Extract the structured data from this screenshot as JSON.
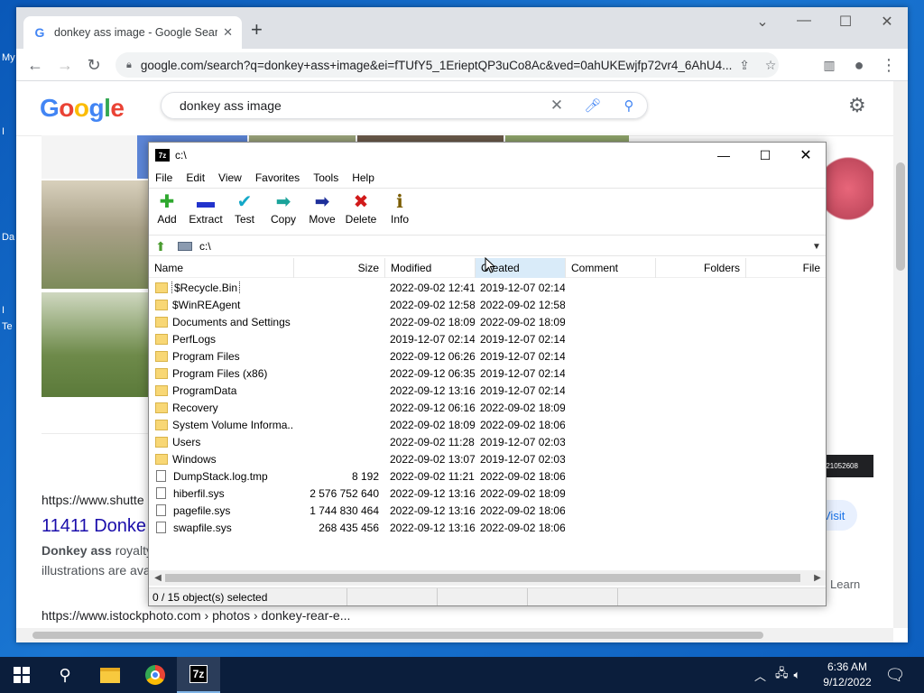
{
  "desktop": {
    "labels": [
      "My",
      "I",
      "Da",
      "I",
      "Te"
    ]
  },
  "chrome": {
    "tab_title": "donkey ass image - Google Sear",
    "url": "google.com/search?q=donkey+ass+image&ei=fTUfY5_1ErieptQP3uCo8Ac&ved=0ahUKEwjfp72vr4_6AhU4...",
    "window_controls": {
      "minimize": "—",
      "maximize": "☐",
      "close": "✕"
    }
  },
  "google": {
    "logo": "Google",
    "query": "donkey ass image",
    "result1_url": "https://www.shutte",
    "result1_title": "11411 Donke",
    "result1_snippet_bold": "Donkey ass",
    "result1_snippet_rest": " royalty",
    "result1_snippet_line2": "illustrations are ava",
    "result2_url": "https://www.istockphoto.com › photos › donkey-rear-e...",
    "card_text": "om/21052608",
    "visit": "Visit",
    "learn": "Learn"
  },
  "zip": {
    "title": "c:\\",
    "menu": [
      "File",
      "Edit",
      "View",
      "Favorites",
      "Tools",
      "Help"
    ],
    "toolbar": [
      {
        "label": "Add",
        "icon": "✚",
        "color": "#2ea82e"
      },
      {
        "label": "Extract",
        "icon": "▬",
        "color": "#2233cc"
      },
      {
        "label": "Test",
        "icon": "✔",
        "color": "#14a8c8"
      },
      {
        "label": "Copy",
        "icon": "➡",
        "color": "#1aa39a"
      },
      {
        "label": "Move",
        "icon": "➡",
        "color": "#1e2f9a"
      },
      {
        "label": "Delete",
        "icon": "✖",
        "color": "#d11a1a"
      },
      {
        "label": "Info",
        "icon": "ℹ",
        "color": "#7a5c00"
      }
    ],
    "address": "c:\\",
    "columns": [
      "Name",
      "Size",
      "Modified",
      "Created",
      "Comment",
      "Folders",
      "File"
    ],
    "rows": [
      {
        "name": "$Recycle.Bin",
        "type": "folder",
        "size": "",
        "modified": "2022-09-02 12:41",
        "created": "2019-12-07 02:14"
      },
      {
        "name": "$WinREAgent",
        "type": "folder",
        "size": "",
        "modified": "2022-09-02 12:58",
        "created": "2022-09-02 12:58"
      },
      {
        "name": "Documents and Settings",
        "type": "folder",
        "size": "",
        "modified": "2022-09-02 18:09",
        "created": "2022-09-02 18:09"
      },
      {
        "name": "PerfLogs",
        "type": "folder",
        "size": "",
        "modified": "2019-12-07 02:14",
        "created": "2019-12-07 02:14"
      },
      {
        "name": "Program Files",
        "type": "folder",
        "size": "",
        "modified": "2022-09-12 06:26",
        "created": "2019-12-07 02:14"
      },
      {
        "name": "Program Files (x86)",
        "type": "folder",
        "size": "",
        "modified": "2022-09-12 06:35",
        "created": "2019-12-07 02:14"
      },
      {
        "name": "ProgramData",
        "type": "folder",
        "size": "",
        "modified": "2022-09-12 13:16",
        "created": "2019-12-07 02:14"
      },
      {
        "name": "Recovery",
        "type": "folder",
        "size": "",
        "modified": "2022-09-12 06:16",
        "created": "2022-09-02 18:09"
      },
      {
        "name": "System Volume Informa...",
        "type": "folder",
        "size": "",
        "modified": "2022-09-02 18:09",
        "created": "2022-09-02 18:06"
      },
      {
        "name": "Users",
        "type": "folder",
        "size": "",
        "modified": "2022-09-02 11:28",
        "created": "2019-12-07 02:03"
      },
      {
        "name": "Windows",
        "type": "folder",
        "size": "",
        "modified": "2022-09-02 13:07",
        "created": "2019-12-07 02:03"
      },
      {
        "name": "DumpStack.log.tmp",
        "type": "file",
        "size": "8 192",
        "modified": "2022-09-02 11:21",
        "created": "2022-09-02 18:06"
      },
      {
        "name": "hiberfil.sys",
        "type": "file",
        "size": "2 576 752 640",
        "modified": "2022-09-12 13:16",
        "created": "2022-09-02 18:09"
      },
      {
        "name": "pagefile.sys",
        "type": "file",
        "size": "1 744 830 464",
        "modified": "2022-09-12 13:16",
        "created": "2022-09-02 18:06"
      },
      {
        "name": "swapfile.sys",
        "type": "file",
        "size": "268 435 456",
        "modified": "2022-09-12 13:16",
        "created": "2022-09-02 18:06"
      }
    ],
    "status": "0 / 15 object(s) selected"
  },
  "taskbar": {
    "time": "6:36 AM",
    "date": "9/12/2022"
  }
}
